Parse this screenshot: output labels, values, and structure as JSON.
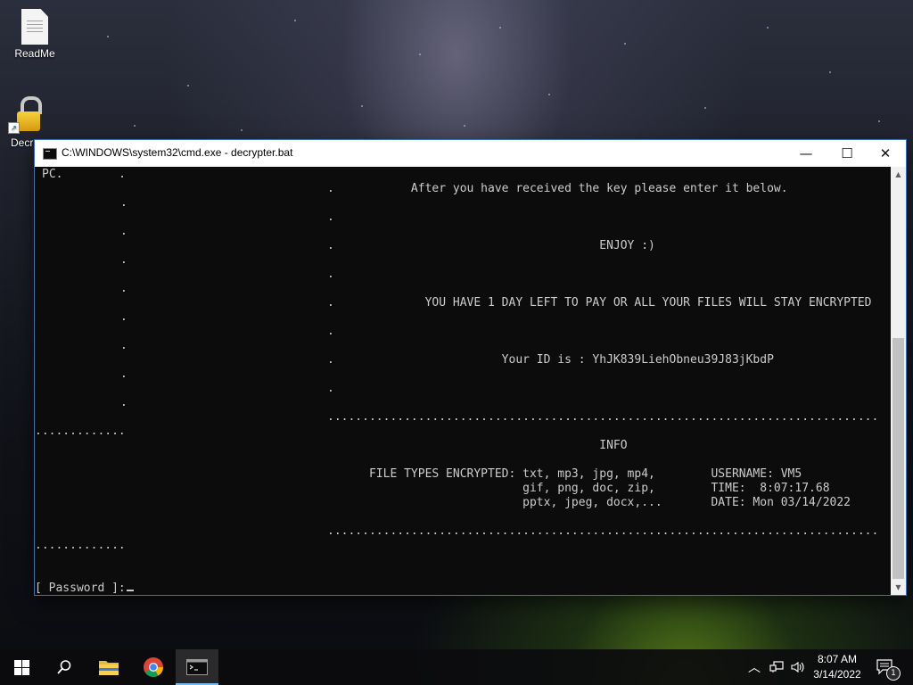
{
  "desktop": {
    "icons": [
      {
        "label": "ReadMe",
        "icon": "document-icon"
      },
      {
        "label": "Decr",
        "icon": "lock-icon"
      }
    ]
  },
  "window": {
    "title": "C:\\WINDOWS\\system32\\cmd.exe - decrypter.bat",
    "controls": {
      "minimize": "—",
      "maximize": "☐",
      "close": "✕"
    }
  },
  "console": {
    "left_column": [
      "PC.        .",
      ".",
      ".",
      ".",
      ".",
      ".",
      ".",
      ".",
      ".",
      ".............",
      "............."
    ],
    "lines": [
      ".           After you have received the key please enter it below.",
      ".",
      ".                                      ENJOY :)",
      ".",
      ".             YOU HAVE 1 DAY LEFT TO PAY OR ALL YOUR FILES WILL STAY ENCRYPTED",
      ".",
      ".                        Your ID is : YhJK839LiehObneu39J83jKbdP",
      ".",
      "...............................................................................",
      "                                       INFO",
      "      FILE TYPES ENCRYPTED: txt, mp3, jpg, mp4,        USERNAME: VM5",
      "                            gif, png, doc, zip,        TIME:  8:07:17.68",
      "                            pptx, jpeg, docx,...       DATE: Mon 03/14/2022",
      "..............................................................................."
    ],
    "prompt": "[ Password ]:"
  },
  "taskbar": {
    "items": [
      "start-button",
      "search-button",
      "file-explorer",
      "chrome",
      "command-prompt"
    ],
    "clock_time": "8:07 AM",
    "clock_date": "3/14/2022",
    "notification_count": "1"
  }
}
